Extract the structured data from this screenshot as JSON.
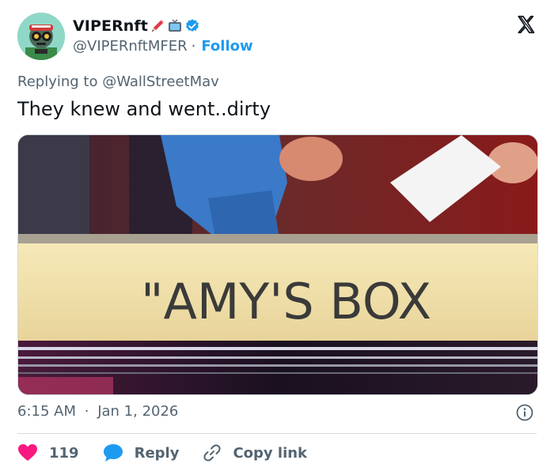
{
  "author": {
    "display_name": "VIPERnft",
    "handle": "@VIPERnftMFER",
    "follow_label": "Follow",
    "separator": "·",
    "badges": [
      "pencil-emoji",
      "tv-emoji",
      "verified-badge"
    ]
  },
  "reply_context": {
    "prefix": "Replying to",
    "mention": "@WallStreetMav"
  },
  "tweet": {
    "text": "They knew and went..dirty",
    "media_caption_text": "\"AMY'S BOX"
  },
  "meta": {
    "time": "6:15 AM",
    "separator": "·",
    "date": "Jan 1, 2026"
  },
  "actions": {
    "likes_count": "119",
    "reply_label": "Reply",
    "copy_link_label": "Copy link"
  },
  "colors": {
    "accent": "#1d9bf0",
    "like": "#f91880",
    "text_primary": "#0f1419",
    "text_secondary": "#536471",
    "border": "#cfd9de"
  },
  "icons": {
    "brand": "x-logo-icon",
    "info": "info-icon",
    "like": "heart-icon",
    "reply": "speech-bubble-icon",
    "copy": "link-icon"
  }
}
